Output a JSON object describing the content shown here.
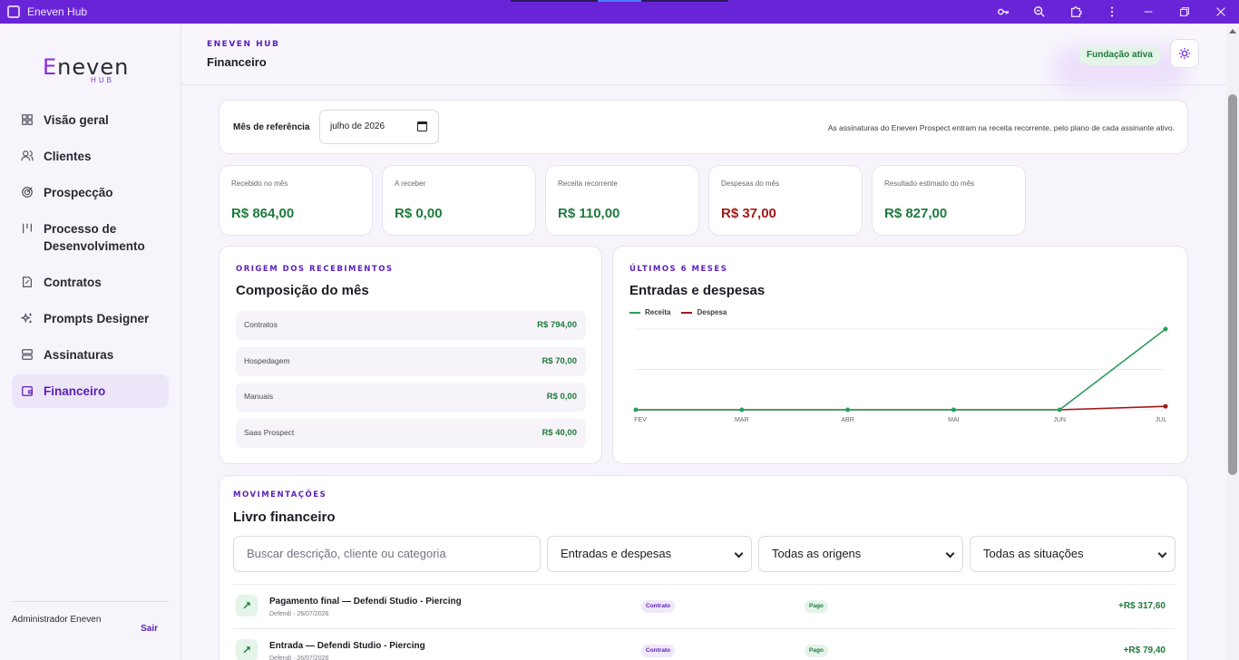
{
  "window": {
    "title": "Eneven Hub"
  },
  "sidebar": {
    "brand": {
      "word": "neven",
      "sub": "HUB",
      "letter": "E"
    },
    "items": [
      {
        "label": "Visão geral",
        "icon": "grid-icon"
      },
      {
        "label": "Clientes",
        "icon": "users-icon"
      },
      {
        "label": "Prospecção",
        "icon": "target-icon"
      },
      {
        "label": "Processo de Desenvolvimento",
        "icon": "pipeline-icon"
      },
      {
        "label": "Contratos",
        "icon": "document-icon"
      },
      {
        "label": "Prompts Designer",
        "icon": "sparkles-icon"
      },
      {
        "label": "Assinaturas",
        "icon": "stack-icon"
      },
      {
        "label": "Financeiro",
        "icon": "wallet-icon",
        "active": true
      }
    ],
    "user": "Administrador Eneven",
    "logout": "Sair"
  },
  "header": {
    "eyebrow": "ENEVEN HUB",
    "title": "Financeiro",
    "badge": "Fundação ativa"
  },
  "reference": {
    "label": "Mês de referência",
    "month": "julho de 2026",
    "note": "As assinaturas do Eneven Prospect entram na receita recorrente, pelo plano de cada assinante ativo."
  },
  "stats": [
    {
      "label": "Recebido no mês",
      "value": "R$ 864,00",
      "tone": "pos"
    },
    {
      "label": "A receber",
      "value": "R$ 0,00",
      "tone": "pos"
    },
    {
      "label": "Receita recorrente",
      "value": "R$ 110,00",
      "tone": "pos"
    },
    {
      "label": "Despesas do mês",
      "value": "R$ 37,00",
      "tone": "neg"
    },
    {
      "label": "Resultado estimado do mês",
      "value": "R$ 827,00",
      "tone": "pos"
    }
  ],
  "composition": {
    "eyebrow": "ORIGEM DOS RECEBIMENTOS",
    "title": "Composição do mês",
    "rows": [
      {
        "name": "Contratos",
        "value": "R$ 794,00"
      },
      {
        "name": "Hospedagem",
        "value": "R$ 70,00"
      },
      {
        "name": "Manuais",
        "value": "R$ 0,00"
      },
      {
        "name": "Saas Prospect",
        "value": "R$ 40,00"
      }
    ]
  },
  "trend": {
    "eyebrow": "ÚLTIMOS 6 MESES",
    "title": "Entradas e despesas"
  },
  "chart_data": {
    "type": "line",
    "categories": [
      "FEV",
      "MAR",
      "ABR",
      "MAI",
      "JUN",
      "JUL"
    ],
    "series": [
      {
        "name": "Receita",
        "values": [
          0,
          0,
          0,
          0,
          0,
          864
        ],
        "color": "#2a9d5c"
      },
      {
        "name": "Despesa",
        "values": [
          0,
          0,
          0,
          0,
          0,
          37
        ],
        "color": "#a31818"
      }
    ],
    "ylim": [
      0,
      864
    ],
    "grid": true,
    "legend": "top-left"
  },
  "ledger": {
    "eyebrow": "MOVIMENTAÇÕES",
    "title": "Livro financeiro",
    "search_placeholder": "Buscar descrição, cliente ou categoria",
    "filters": [
      "Entradas e despesas",
      "Todas as origens",
      "Todas as situações"
    ],
    "rows": [
      {
        "desc": "Pagamento final — Defendi Studio - Piercing",
        "meta": "Defendi · 26/07/2026",
        "kind": "Contrato",
        "status": "Pago",
        "amount": "+R$ 317,60"
      },
      {
        "desc": "Entrada — Defendi Studio - Piercing",
        "meta": "Defendi · 26/07/2026",
        "kind": "Contrato",
        "status": "Pago",
        "amount": "+R$ 79,40"
      }
    ]
  },
  "colors": {
    "accent": "#6a24d8",
    "positive": "#1f7a3d",
    "negative": "#a31818"
  }
}
